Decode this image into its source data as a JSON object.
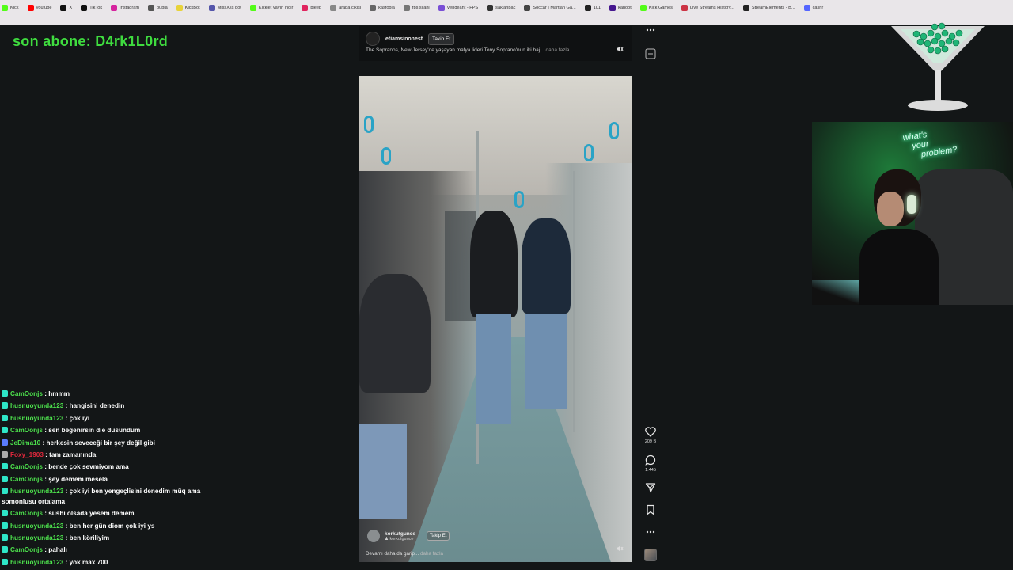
{
  "bookmarks": [
    {
      "label": "Kick",
      "color": "#53fc18"
    },
    {
      "label": "youtube",
      "color": "#ff0000"
    },
    {
      "label": "X",
      "color": "#111111"
    },
    {
      "label": "TikTok",
      "color": "#111111"
    },
    {
      "label": "Instagram",
      "color": "#d6249f"
    },
    {
      "label": "bubla",
      "color": "#555555"
    },
    {
      "label": "KickBot",
      "color": "#e8d33a"
    },
    {
      "label": "MissXss bot",
      "color": "#5555aa"
    },
    {
      "label": "Kicklet yayın indir",
      "color": "#53fc18"
    },
    {
      "label": "bleep",
      "color": "#e0245e"
    },
    {
      "label": "araba cikisi",
      "color": "#888888"
    },
    {
      "label": "kasfopla",
      "color": "#666666"
    },
    {
      "label": "fps silahi",
      "color": "#777777"
    },
    {
      "label": "Vengeant - FPS",
      "color": "#7a4fd6"
    },
    {
      "label": "saklanbaç",
      "color": "#333333"
    },
    {
      "label": "Soccar | Martian Ga...",
      "color": "#444444"
    },
    {
      "label": "101",
      "color": "#222222"
    },
    {
      "label": "kahoot",
      "color": "#46178f"
    },
    {
      "label": "Kick Games",
      "color": "#53fc18"
    },
    {
      "label": "Live Streams History...",
      "color": "#cc3344"
    },
    {
      "label": "StreamElements - B...",
      "color": "#222222"
    },
    {
      "label": "cashr",
      "color": "#5566ff"
    }
  ],
  "overlay": {
    "title": "son abone: D4rk1L0rd",
    "title_color": "#3fdc3f"
  },
  "reel": {
    "header_account": "etiamsinonest",
    "follow_label": "Takip Et",
    "caption": "The Sopranos, New Jersey'de yaşayan mafya lideri Tony Soprano'nun iki haj...",
    "caption_more": "daha fazla",
    "footer_account": "korkutgunce",
    "footer_handle": "korkutgunce",
    "footer_follow_label": "Takip Et",
    "footer_caption": "Devamı daha da garip...",
    "footer_more": "daha fazla"
  },
  "actions": {
    "menu_icon": "more-horizontal-icon",
    "like_count": "209 B",
    "comment_count": "1.445"
  },
  "webcam": {
    "neon_line1": "what's",
    "neon_line2": "your",
    "neon_line3": "problem?"
  },
  "chat": [
    {
      "user": "CamOonjs",
      "text": "hmmm",
      "user_color": "#4de34d",
      "badge_color": "#2ee6c8"
    },
    {
      "user": "husnuoyunda123",
      "text": "hangisini denedin",
      "user_color": "#4de34d",
      "badge_color": "#2ee6c8"
    },
    {
      "user": "husnuoyunda123",
      "text": "çok iyi",
      "user_color": "#4de34d",
      "badge_color": "#2ee6c8"
    },
    {
      "user": "CamOonjs",
      "text": "sen beğenirsin die düsündüm",
      "user_color": "#4de34d",
      "badge_color": "#2ee6c8"
    },
    {
      "user": "JeDima10",
      "text": "herkesin seveceği bir şey değil gibi",
      "user_color": "#4de34d",
      "badge_color": "#5a7cff"
    },
    {
      "user": "Foxy_1903",
      "text": "tam zamanında",
      "user_color": "#e0283c",
      "badge_color": "#aaaaaa"
    },
    {
      "user": "CamOonjs",
      "text": "bende çok sevmiyom ama",
      "user_color": "#4de34d",
      "badge_color": "#2ee6c8"
    },
    {
      "user": "CamOonjs",
      "text": "şey demem mesela",
      "user_color": "#4de34d",
      "badge_color": "#2ee6c8"
    },
    {
      "user": "husnuoyunda123",
      "text": "çok iyi ben yengeçlisini denedim müq ama somonlusu ortalama",
      "user_color": "#4de34d",
      "badge_color": "#2ee6c8"
    },
    {
      "user": "CamOonjs",
      "text": "sushi olsada yesem demem",
      "user_color": "#4de34d",
      "badge_color": "#2ee6c8"
    },
    {
      "user": "husnuoyunda123",
      "text": "ben her gün diom çok iyi ys",
      "user_color": "#4de34d",
      "badge_color": "#2ee6c8"
    },
    {
      "user": "husnuoyunda123",
      "text": "ben köriliyim",
      "user_color": "#4de34d",
      "badge_color": "#2ee6c8"
    },
    {
      "user": "CamOonjs",
      "text": "pahalı",
      "user_color": "#4de34d",
      "badge_color": "#2ee6c8"
    },
    {
      "user": "husnuoyunda123",
      "text": "yok max 700",
      "user_color": "#4de34d",
      "badge_color": "#2ee6c8"
    }
  ]
}
